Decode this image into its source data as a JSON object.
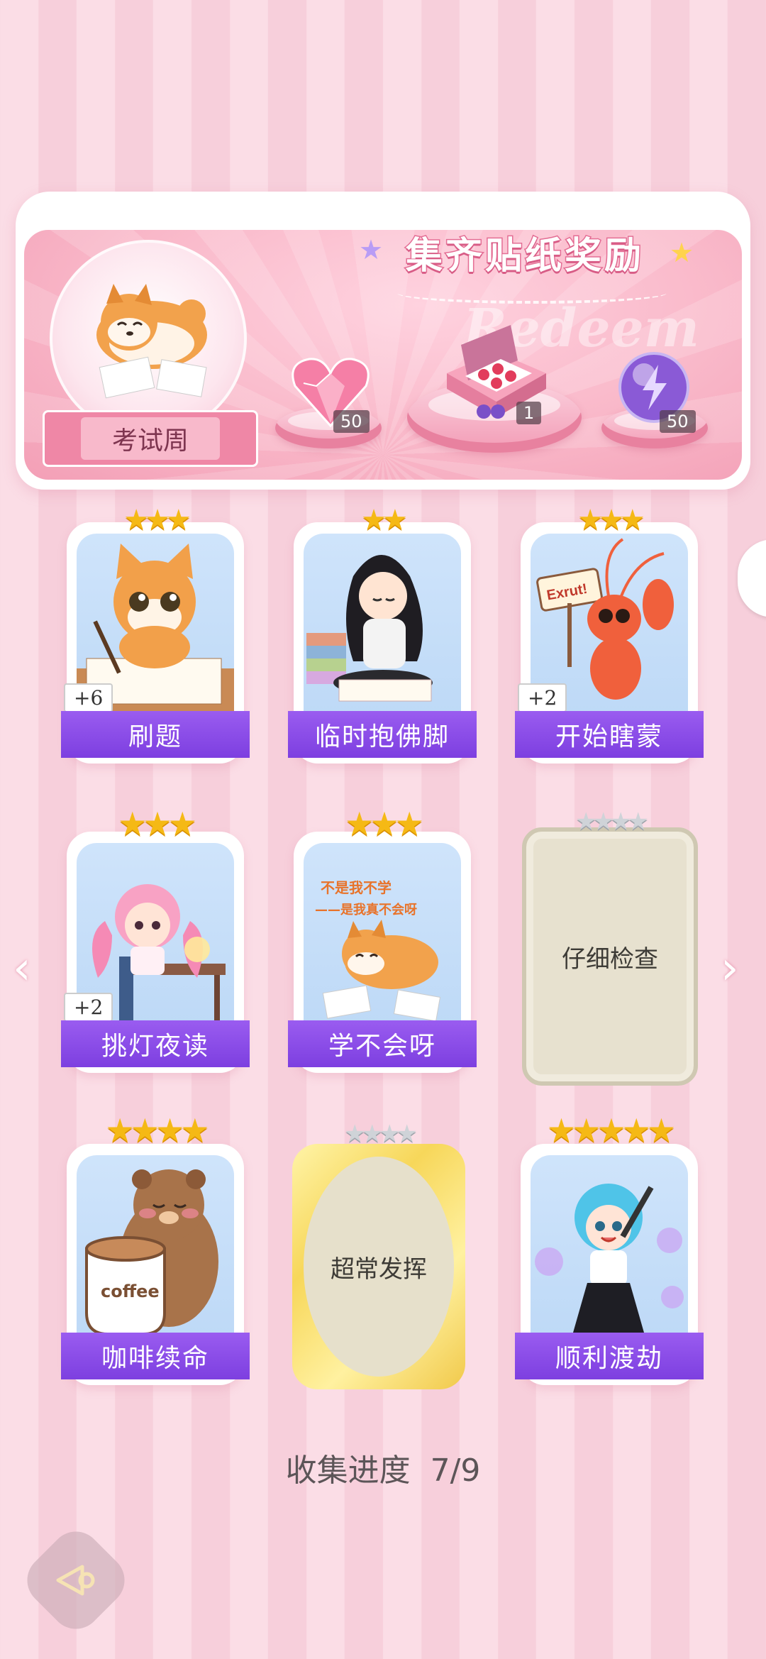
{
  "banner": {
    "title": "集齐贴纸奖励",
    "ghost_word": "Redeem",
    "theme_label": "考试周",
    "rewards": [
      {
        "name": "heart-gem",
        "count": "50"
      },
      {
        "name": "gift-box",
        "count": "1"
      },
      {
        "name": "purple-orb",
        "count": "50"
      }
    ]
  },
  "cards": [
    {
      "label": "刷题",
      "bonus": "+6",
      "stars": 3,
      "filled": 3
    },
    {
      "label": "临时抱佛脚",
      "bonus": "",
      "stars": 2,
      "filled": 2
    },
    {
      "label": "开始瞎蒙",
      "bonus": "+2",
      "stars": 3,
      "filled": 3
    },
    {
      "label": "挑灯夜读",
      "bonus": "+2",
      "stars": 3,
      "filled": 3
    },
    {
      "label": "学不会呀",
      "bonus": "",
      "stars": 3,
      "filled": 3
    },
    {
      "label": "仔细检查",
      "bonus": "",
      "stars": 4,
      "filled": 0
    },
    {
      "label": "咖啡续命",
      "bonus": "",
      "stars": 4,
      "filled": 4
    },
    {
      "label": "超常发挥",
      "bonus": "",
      "stars": 4,
      "filled": 0
    },
    {
      "label": "顺利渡劫",
      "bonus": "",
      "stars": 5,
      "filled": 5
    }
  ],
  "sticker_texts": {
    "shrimp_sign": "Exrut!",
    "dog_caption_1": "不是我不学",
    "dog_caption_2": "——是我真不会呀",
    "coffee_cup": "coffee"
  },
  "progress": {
    "label": "收集进度",
    "value": "7/9"
  }
}
